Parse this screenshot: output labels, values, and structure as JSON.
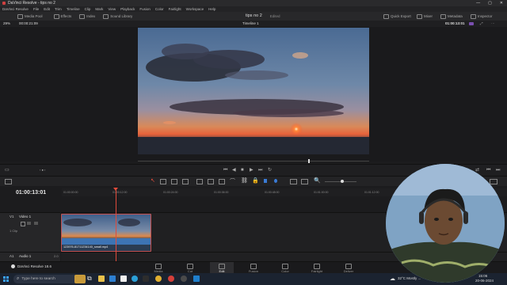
{
  "app": {
    "window_title": "DaVinci Resolve - tips no 2",
    "menu": [
      "DaVinci Resolve",
      "File",
      "Edit",
      "Trim",
      "Timeline",
      "Clip",
      "Mark",
      "View",
      "Playback",
      "Fusion",
      "Color",
      "Fairlight",
      "Workspace",
      "Help"
    ]
  },
  "toolbar": {
    "left": [
      "Media Pool",
      "Effects",
      "Index",
      "Sound Library"
    ],
    "project_name": "tips no 2",
    "project_status": "Edited",
    "right": [
      "Quick Export",
      "Mixer",
      "Metadata",
      "Inspector"
    ]
  },
  "viewer": {
    "zoom": "29%",
    "source_tc": "00:00:21:09",
    "timeline_name": "Timeline 1",
    "record_tc": "01:00:13:01"
  },
  "timeline": {
    "timecode": "01:00:13:01",
    "ruler": [
      "01:00:00:00",
      "01:00:12:00",
      "01:00:24:00",
      "01:00:36:00",
      "01:00:48:00",
      "01:01:00:00",
      "01:01:12:00"
    ],
    "video_track": {
      "id": "V1",
      "name": "Video 1",
      "clips_label": "1 Clip"
    },
    "audio_track": {
      "id": "A1",
      "name": "Audio 1",
      "level": "2.0"
    },
    "clip_name": "123976-81711234140_small.mp4"
  },
  "pages": [
    "Media",
    "Cut",
    "Edit",
    "Fusion",
    "Color",
    "Fairlight",
    "Deliver"
  ],
  "active_page": "Edit",
  "resolve_version": "DaVinci Resolve 18.6",
  "taskbar": {
    "search_placeholder": "Type here to search",
    "weather": "32°C  Mostly ...",
    "time": "15:06",
    "date": "20-06-2024"
  },
  "colors": {
    "accent_red": "#e04b3b",
    "clip_border": "#c25050",
    "bg": "#1c1c1e"
  }
}
